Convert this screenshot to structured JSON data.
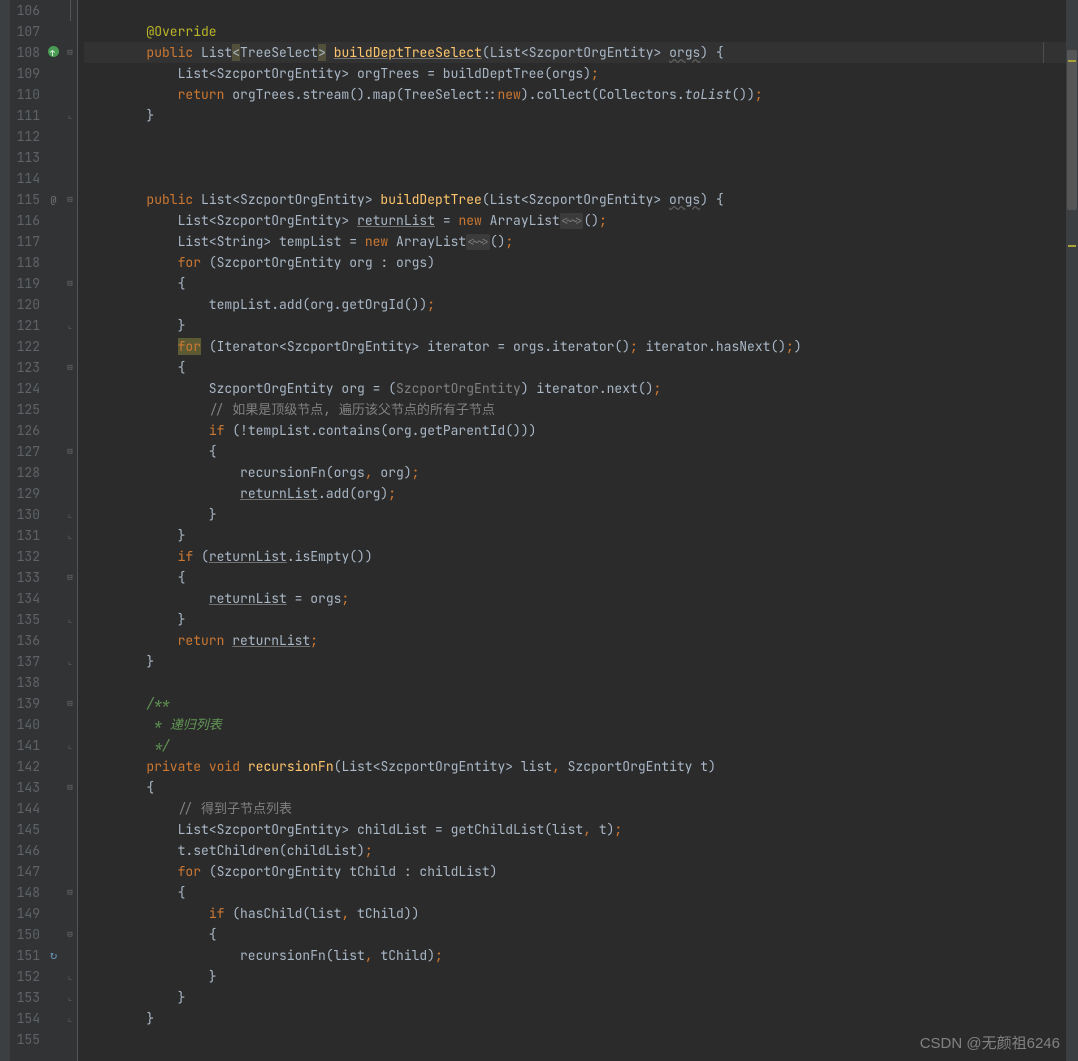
{
  "watermark": "CSDN @无颜祖6246",
  "current_line": 108,
  "lines": [
    {
      "n": 106,
      "annot": "",
      "fold": "",
      "tokens": [
        {
          "t": "",
          "c": ""
        }
      ]
    },
    {
      "n": 107,
      "annot": "",
      "fold": "",
      "tokens": [
        {
          "t": "        ",
          "c": ""
        },
        {
          "t": "@Override",
          "c": "anno"
        }
      ]
    },
    {
      "n": 108,
      "annot": "override",
      "fold": "open",
      "tokens": [
        {
          "t": "        ",
          "c": ""
        },
        {
          "t": "public",
          "c": "kw"
        },
        {
          "t": " List",
          "c": ""
        },
        {
          "t": "<",
          "c": "bad"
        },
        {
          "t": "TreeSelect",
          "c": ""
        },
        {
          "t": ">",
          "c": "bad"
        },
        {
          "t": " ",
          "c": ""
        },
        {
          "t": "buildDeptTreeSelect",
          "c": "mdecl underline"
        },
        {
          "t": "(List<SzcportOrgEntity> ",
          "c": ""
        },
        {
          "t": "orgs",
          "c": "param"
        },
        {
          "t": ") {",
          "c": ""
        }
      ]
    },
    {
      "n": 109,
      "annot": "",
      "fold": "",
      "tokens": [
        {
          "t": "            List<SzcportOrgEntity> orgTrees = buildDeptTree(",
          "c": ""
        },
        {
          "t": "orgs",
          "c": ""
        },
        {
          "t": ")",
          "c": ""
        },
        {
          "t": ";",
          "c": "semicolon"
        }
      ]
    },
    {
      "n": 110,
      "annot": "",
      "fold": "",
      "tokens": [
        {
          "t": "            ",
          "c": ""
        },
        {
          "t": "return",
          "c": "kw"
        },
        {
          "t": " orgTrees.stream().map(TreeSelect",
          "c": ""
        },
        {
          "t": "::",
          "c": ""
        },
        {
          "t": "new",
          "c": "kw"
        },
        {
          "t": ").collect(Collectors.",
          "c": ""
        },
        {
          "t": "toList",
          "c": "ital"
        },
        {
          "t": "())",
          "c": ""
        },
        {
          "t": ";",
          "c": "semicolon"
        }
      ]
    },
    {
      "n": 111,
      "annot": "",
      "fold": "close",
      "tokens": [
        {
          "t": "        }",
          "c": ""
        }
      ]
    },
    {
      "n": 112,
      "annot": "",
      "fold": "",
      "tokens": [
        {
          "t": "",
          "c": ""
        }
      ]
    },
    {
      "n": 113,
      "annot": "",
      "fold": "",
      "tokens": [
        {
          "t": "",
          "c": ""
        }
      ]
    },
    {
      "n": 114,
      "annot": "",
      "fold": "",
      "tokens": [
        {
          "t": "",
          "c": ""
        }
      ]
    },
    {
      "n": 115,
      "annot": "@",
      "fold": "open",
      "tokens": [
        {
          "t": "        ",
          "c": ""
        },
        {
          "t": "public",
          "c": "kw"
        },
        {
          "t": " List<SzcportOrgEntity> ",
          "c": ""
        },
        {
          "t": "buildDeptTree",
          "c": "mdecl"
        },
        {
          "t": "(List<SzcportOrgEntity> ",
          "c": ""
        },
        {
          "t": "orgs",
          "c": "param"
        },
        {
          "t": ") {",
          "c": ""
        }
      ]
    },
    {
      "n": 116,
      "annot": "",
      "fold": "",
      "tokens": [
        {
          "t": "            List<SzcportOrgEntity> ",
          "c": ""
        },
        {
          "t": "returnList",
          "c": "underline"
        },
        {
          "t": " = ",
          "c": ""
        },
        {
          "t": "new",
          "c": "kw"
        },
        {
          "t": " ArrayList",
          "c": ""
        },
        {
          "t": "<~>",
          "c": "inlay"
        },
        {
          "t": "()",
          "c": ""
        },
        {
          "t": ";",
          "c": "semicolon"
        }
      ]
    },
    {
      "n": 117,
      "annot": "",
      "fold": "",
      "tokens": [
        {
          "t": "            List<String> tempList = ",
          "c": ""
        },
        {
          "t": "new",
          "c": "kw"
        },
        {
          "t": " ArrayList",
          "c": ""
        },
        {
          "t": "<~>",
          "c": "inlay"
        },
        {
          "t": "()",
          "c": ""
        },
        {
          "t": ";",
          "c": "semicolon"
        }
      ]
    },
    {
      "n": 118,
      "annot": "",
      "fold": "",
      "tokens": [
        {
          "t": "            ",
          "c": ""
        },
        {
          "t": "for",
          "c": "kw"
        },
        {
          "t": " (SzcportOrgEntity org : orgs)",
          "c": ""
        }
      ]
    },
    {
      "n": 119,
      "annot": "",
      "fold": "open",
      "tokens": [
        {
          "t": "            {",
          "c": ""
        }
      ]
    },
    {
      "n": 120,
      "annot": "",
      "fold": "",
      "tokens": [
        {
          "t": "                tempList.add(org.getOrgId())",
          "c": ""
        },
        {
          "t": ";",
          "c": "semicolon"
        }
      ]
    },
    {
      "n": 121,
      "annot": "",
      "fold": "close",
      "tokens": [
        {
          "t": "            }",
          "c": ""
        }
      ]
    },
    {
      "n": 122,
      "annot": "",
      "fold": "",
      "tokens": [
        {
          "t": "            ",
          "c": ""
        },
        {
          "t": "for",
          "c": "kw hl"
        },
        {
          "t": " (Iterator<SzcportOrgEntity> iterator = orgs.iterator()",
          "c": ""
        },
        {
          "t": ";",
          "c": "semicolon"
        },
        {
          "t": " iterator.hasNext()",
          "c": ""
        },
        {
          "t": ";",
          "c": "semicolon"
        },
        {
          "t": ")",
          "c": ""
        }
      ]
    },
    {
      "n": 123,
      "annot": "",
      "fold": "open",
      "tokens": [
        {
          "t": "            {",
          "c": ""
        }
      ]
    },
    {
      "n": 124,
      "annot": "",
      "fold": "",
      "tokens": [
        {
          "t": "                SzcportOrgEntity org = (",
          "c": ""
        },
        {
          "t": "SzcportOrgEntity",
          "c": "cast"
        },
        {
          "t": ") iterator.next()",
          "c": ""
        },
        {
          "t": ";",
          "c": "semicolon"
        }
      ]
    },
    {
      "n": 125,
      "annot": "",
      "fold": "",
      "tokens": [
        {
          "t": "                ",
          "c": ""
        },
        {
          "t": "// 如果是顶级节点, 遍历该父节点的所有子节点",
          "c": "cmt"
        }
      ]
    },
    {
      "n": 126,
      "annot": "",
      "fold": "",
      "tokens": [
        {
          "t": "                ",
          "c": ""
        },
        {
          "t": "if",
          "c": "kw"
        },
        {
          "t": " (!tempList.contains(org.getParentId()))",
          "c": ""
        }
      ]
    },
    {
      "n": 127,
      "annot": "",
      "fold": "open",
      "tokens": [
        {
          "t": "                {",
          "c": ""
        }
      ]
    },
    {
      "n": 128,
      "annot": "",
      "fold": "",
      "tokens": [
        {
          "t": "                    recursionFn(orgs",
          "c": ""
        },
        {
          "t": ",",
          "c": "semicolon"
        },
        {
          "t": " org)",
          "c": ""
        },
        {
          "t": ";",
          "c": "semicolon"
        }
      ]
    },
    {
      "n": 129,
      "annot": "",
      "fold": "",
      "tokens": [
        {
          "t": "                    ",
          "c": ""
        },
        {
          "t": "returnList",
          "c": "underline"
        },
        {
          "t": ".add(org)",
          "c": ""
        },
        {
          "t": ";",
          "c": "semicolon"
        }
      ]
    },
    {
      "n": 130,
      "annot": "",
      "fold": "close",
      "tokens": [
        {
          "t": "                }",
          "c": ""
        }
      ]
    },
    {
      "n": 131,
      "annot": "",
      "fold": "close",
      "tokens": [
        {
          "t": "            }",
          "c": ""
        }
      ]
    },
    {
      "n": 132,
      "annot": "",
      "fold": "",
      "tokens": [
        {
          "t": "            ",
          "c": ""
        },
        {
          "t": "if",
          "c": "kw"
        },
        {
          "t": " (",
          "c": ""
        },
        {
          "t": "returnList",
          "c": "underline"
        },
        {
          "t": ".isEmpty())",
          "c": ""
        }
      ]
    },
    {
      "n": 133,
      "annot": "",
      "fold": "open",
      "tokens": [
        {
          "t": "            {",
          "c": ""
        }
      ]
    },
    {
      "n": 134,
      "annot": "",
      "fold": "",
      "tokens": [
        {
          "t": "                ",
          "c": ""
        },
        {
          "t": "returnList",
          "c": "underline"
        },
        {
          "t": " = orgs",
          "c": ""
        },
        {
          "t": ";",
          "c": "semicolon"
        }
      ]
    },
    {
      "n": 135,
      "annot": "",
      "fold": "close",
      "tokens": [
        {
          "t": "            }",
          "c": ""
        }
      ]
    },
    {
      "n": 136,
      "annot": "",
      "fold": "",
      "tokens": [
        {
          "t": "            ",
          "c": ""
        },
        {
          "t": "return",
          "c": "kw"
        },
        {
          "t": " ",
          "c": ""
        },
        {
          "t": "returnList",
          "c": "underline"
        },
        {
          "t": ";",
          "c": "semicolon"
        }
      ]
    },
    {
      "n": 137,
      "annot": "",
      "fold": "close",
      "tokens": [
        {
          "t": "        }",
          "c": ""
        }
      ]
    },
    {
      "n": 138,
      "annot": "",
      "fold": "",
      "tokens": [
        {
          "t": "",
          "c": ""
        }
      ]
    },
    {
      "n": 139,
      "annot": "",
      "fold": "open",
      "tokens": [
        {
          "t": "        ",
          "c": ""
        },
        {
          "t": "/**",
          "c": "doc"
        }
      ]
    },
    {
      "n": 140,
      "annot": "",
      "fold": "",
      "tokens": [
        {
          "t": "         ",
          "c": ""
        },
        {
          "t": "* 递归列表",
          "c": "doc"
        }
      ]
    },
    {
      "n": 141,
      "annot": "",
      "fold": "close",
      "tokens": [
        {
          "t": "         ",
          "c": ""
        },
        {
          "t": "*/",
          "c": "doc"
        }
      ]
    },
    {
      "n": 142,
      "annot": "",
      "fold": "",
      "tokens": [
        {
          "t": "        ",
          "c": ""
        },
        {
          "t": "private",
          "c": "kw"
        },
        {
          "t": " ",
          "c": ""
        },
        {
          "t": "void",
          "c": "kw"
        },
        {
          "t": " ",
          "c": ""
        },
        {
          "t": "recursionFn",
          "c": "mdecl"
        },
        {
          "t": "(List<SzcportOrgEntity> list",
          "c": ""
        },
        {
          "t": ",",
          "c": "semicolon"
        },
        {
          "t": " SzcportOrgEntity t)",
          "c": ""
        }
      ]
    },
    {
      "n": 143,
      "annot": "",
      "fold": "open",
      "tokens": [
        {
          "t": "        {",
          "c": ""
        }
      ]
    },
    {
      "n": 144,
      "annot": "",
      "fold": "",
      "tokens": [
        {
          "t": "            ",
          "c": ""
        },
        {
          "t": "// 得到子节点列表",
          "c": "cmt"
        }
      ]
    },
    {
      "n": 145,
      "annot": "",
      "fold": "",
      "tokens": [
        {
          "t": "            List<SzcportOrgEntity> childList = getChildList(list",
          "c": ""
        },
        {
          "t": ",",
          "c": "semicolon"
        },
        {
          "t": " t)",
          "c": ""
        },
        {
          "t": ";",
          "c": "semicolon"
        }
      ]
    },
    {
      "n": 146,
      "annot": "",
      "fold": "",
      "tokens": [
        {
          "t": "            t.setChildren(childList)",
          "c": ""
        },
        {
          "t": ";",
          "c": "semicolon"
        }
      ]
    },
    {
      "n": 147,
      "annot": "",
      "fold": "",
      "tokens": [
        {
          "t": "            ",
          "c": ""
        },
        {
          "t": "for",
          "c": "kw"
        },
        {
          "t": " (SzcportOrgEntity tChild : childList)",
          "c": ""
        }
      ]
    },
    {
      "n": 148,
      "annot": "",
      "fold": "open",
      "tokens": [
        {
          "t": "            {",
          "c": ""
        }
      ]
    },
    {
      "n": 149,
      "annot": "",
      "fold": "",
      "tokens": [
        {
          "t": "                ",
          "c": ""
        },
        {
          "t": "if",
          "c": "kw"
        },
        {
          "t": " (hasChild(list",
          "c": ""
        },
        {
          "t": ",",
          "c": "semicolon"
        },
        {
          "t": " tChild))",
          "c": ""
        }
      ]
    },
    {
      "n": 150,
      "annot": "",
      "fold": "open",
      "tokens": [
        {
          "t": "                {",
          "c": ""
        }
      ]
    },
    {
      "n": 151,
      "annot": "recur",
      "fold": "",
      "tokens": [
        {
          "t": "                    recursionFn(list",
          "c": ""
        },
        {
          "t": ",",
          "c": "semicolon"
        },
        {
          "t": " tChild)",
          "c": ""
        },
        {
          "t": ";",
          "c": "semicolon"
        }
      ]
    },
    {
      "n": 152,
      "annot": "",
      "fold": "close",
      "tokens": [
        {
          "t": "                }",
          "c": ""
        }
      ]
    },
    {
      "n": 153,
      "annot": "",
      "fold": "close",
      "tokens": [
        {
          "t": "            }",
          "c": ""
        }
      ]
    },
    {
      "n": 154,
      "annot": "",
      "fold": "close",
      "tokens": [
        {
          "t": "        }",
          "c": ""
        }
      ]
    },
    {
      "n": 155,
      "annot": "",
      "fold": "",
      "tokens": [
        {
          "t": "",
          "c": ""
        }
      ]
    }
  ]
}
